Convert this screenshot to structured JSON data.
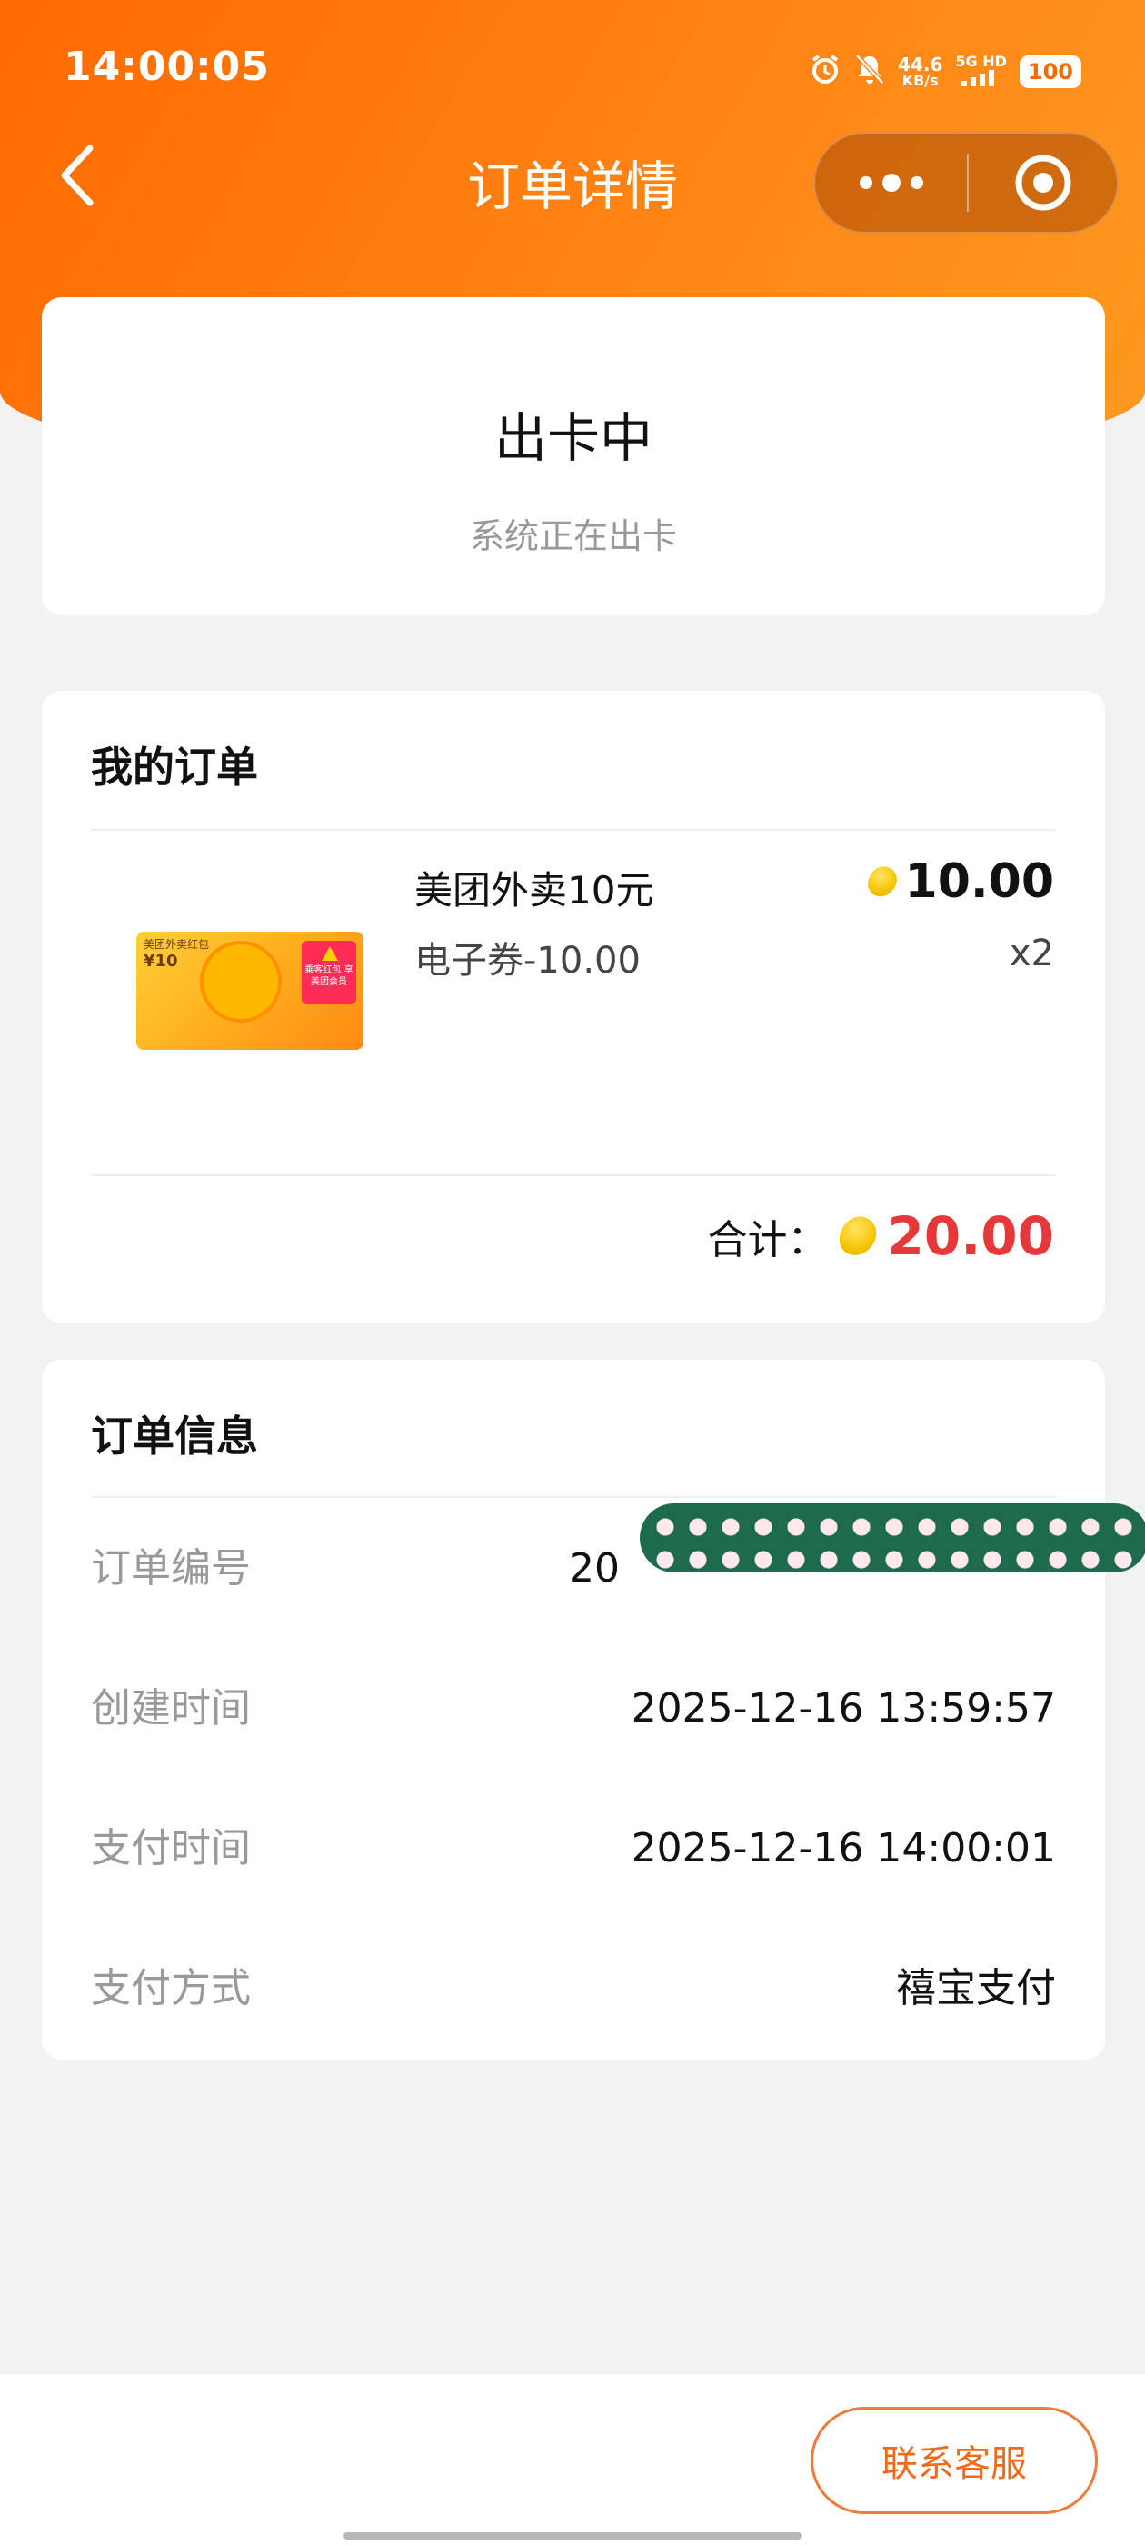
{
  "status_bar": {
    "time": "14:00:05",
    "net_speed_top": "44.6",
    "net_speed_bottom": "KB/s",
    "signal_top": "5G HD",
    "battery": "100"
  },
  "nav": {
    "title": "订单详情"
  },
  "status_card": {
    "title": "出卡中",
    "desc": "系统正在出卡"
  },
  "order_card": {
    "title": "我的订单",
    "product": {
      "thumb_text_1": "美团外卖红包",
      "thumb_text_2": "¥10",
      "thumb_badge": "乘客红包 享美团会员",
      "name": "美团外卖10元",
      "spec": "电子券-10.00",
      "price": "10.00",
      "qty": "x2"
    },
    "total_label": "合计：",
    "total_value": "20.00",
    "accent_color": "#e5383b"
  },
  "info_card": {
    "title": "订单信息",
    "rows": [
      {
        "label": "订单编号",
        "value": "20"
      },
      {
        "label": "创建时间",
        "value": "2025-12-16 13:59:57"
      },
      {
        "label": "支付时间",
        "value": "2025-12-16 14:00:01"
      },
      {
        "label": "支付方式",
        "value": "禧宝支付"
      }
    ]
  },
  "footer": {
    "contact_label": "联系客服"
  },
  "colors": {
    "brand": "#ff6a00",
    "button_text": "#f06a1a"
  }
}
